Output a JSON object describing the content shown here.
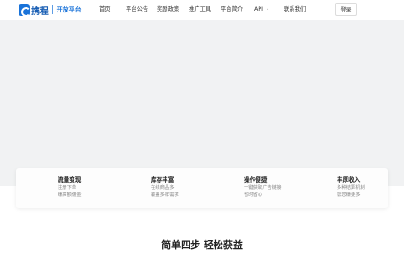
{
  "brand": {
    "name": "携程",
    "subtitle": "开放平台",
    "accent": "#1a73d9"
  },
  "nav": {
    "items": [
      {
        "label": "首页"
      },
      {
        "label": "平台公告"
      },
      {
        "label": "奖励政策"
      },
      {
        "label": "推广工具"
      },
      {
        "label": "平台简介"
      },
      {
        "label": "API",
        "icon": "chevron-down-icon"
      },
      {
        "label": "联系我们"
      }
    ],
    "login_label": "登录"
  },
  "features": [
    {
      "title": "流量变现",
      "lines": [
        "注册下单",
        "赚高额佣金"
      ]
    },
    {
      "title": "库存丰富",
      "lines": [
        "在线商品多",
        "覆盖多样需求"
      ]
    },
    {
      "title": "操作便捷",
      "lines": [
        "一键获取广告链接",
        "省时省心"
      ]
    },
    {
      "title": "丰厚收入",
      "lines": [
        "多种结算机制",
        "帮您赚更多"
      ]
    }
  ],
  "section": {
    "title": "简单四步 轻松获益"
  }
}
